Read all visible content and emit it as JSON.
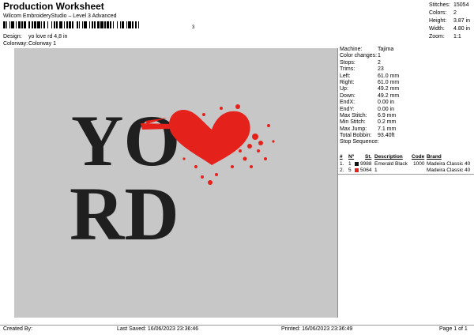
{
  "header": {
    "title": "Production Worksheet",
    "subtitle": "Wilcom EmbroideryStudio – Level 3 Advanced",
    "barcode_number": "3",
    "design_label": "Design:",
    "design_value": "yo love rd 4,8 in",
    "colorway_label": "Colorway:",
    "colorway_value": "Colorway 1"
  },
  "stats": [
    {
      "label": "Stitches:",
      "value": "15054"
    },
    {
      "label": "Colors:",
      "value": "2"
    },
    {
      "label": "Height:",
      "value": "3.87 in"
    },
    {
      "label": "Width:",
      "value": "4.80 in"
    },
    {
      "label": "Zoom:",
      "value": "1:1"
    }
  ],
  "design_preview": {
    "line1": "YO",
    "line2": "RD",
    "text_color": "#1f1f1f",
    "heart_color": "#e4221b",
    "background": "#c7c7c7"
  },
  "machine_info": [
    {
      "label": "Machine:",
      "value": "Tajima"
    },
    {
      "label": "Color changes:",
      "value": "1"
    },
    {
      "label": "Stops:",
      "value": "2"
    },
    {
      "label": "Trims:",
      "value": "23"
    },
    {
      "label": "Left:",
      "value": "61.0 mm"
    },
    {
      "label": "Right:",
      "value": "61.0 mm"
    },
    {
      "label": "Up:",
      "value": "49.2 mm"
    },
    {
      "label": "Down:",
      "value": "49.2 mm"
    },
    {
      "label": "EndX:",
      "value": "0.00 in"
    },
    {
      "label": "EndY:",
      "value": "0.00 in"
    },
    {
      "label": "Max Stitch:",
      "value": "6.9 mm"
    },
    {
      "label": "Min Stitch:",
      "value": "0.2 mm"
    },
    {
      "label": "Max Jump:",
      "value": "7.1 mm"
    },
    {
      "label": "Total Bobbin:",
      "value": "93.40ft"
    },
    {
      "label": "Stop Sequence:",
      "value": ""
    }
  ],
  "thread_table": {
    "headers": [
      "#",
      "Nº",
      "St.",
      "Description",
      "Code",
      "Brand"
    ],
    "rows": [
      {
        "num": "1.",
        "n": "1",
        "color": "#111111",
        "st": "9988",
        "desc": "Emerald Black",
        "code": "1000",
        "brand": "Madeira Classic 40"
      },
      {
        "num": "2.",
        "n": "5",
        "color": "#e4221b",
        "st": "5064",
        "desc": "1",
        "code": "",
        "brand": "Madeira Classic 40"
      }
    ]
  },
  "footer": {
    "created": "Created By:",
    "saved": "Last Saved: 16/06/2023 23:36:46",
    "printed": "Printed: 16/06/2023 23:36:49",
    "page": "Page 1 of 1"
  }
}
